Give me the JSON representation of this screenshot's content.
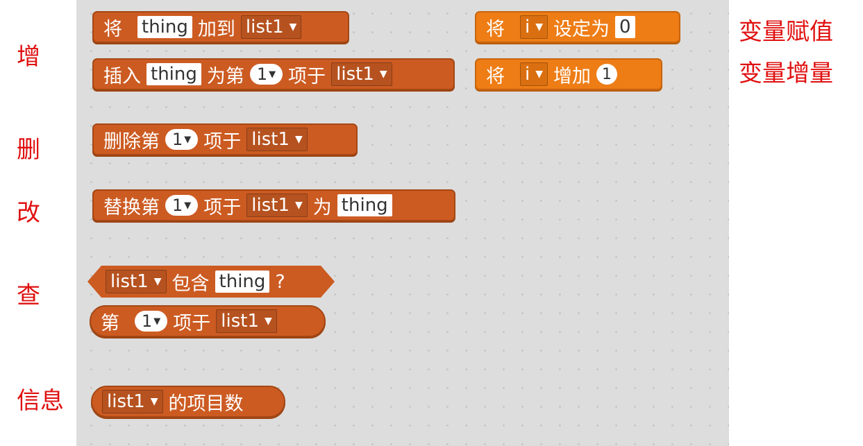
{
  "labels": {
    "add": "增",
    "delete": "删",
    "modify": "改",
    "query": "查",
    "info": "信息",
    "var_assign": "变量赋值",
    "var_increment": "变量增量"
  },
  "blocks": {
    "add_to_list": {
      "word1": "将",
      "item": "thing",
      "word2": "加到",
      "list": "list1"
    },
    "insert_at": {
      "word1": "插入",
      "item": "thing",
      "word2": "为第",
      "index": "1",
      "word3": "项于",
      "list": "list1"
    },
    "delete_item": {
      "word1": "删除第",
      "index": "1",
      "word2": "项于",
      "list": "list1"
    },
    "replace_item": {
      "word1": "替换第",
      "index": "1",
      "word2": "项于",
      "list": "list1",
      "word3": "为",
      "item": "thing"
    },
    "list_contains": {
      "list": "list1",
      "word1": "包含",
      "item": "thing",
      "suffix": "?"
    },
    "item_of": {
      "word1": "第",
      "index": "1",
      "word2": "项于",
      "list": "list1"
    },
    "length_of": {
      "list": "list1",
      "word1": "的项目数"
    },
    "set_var": {
      "word1": "将",
      "var": "i",
      "word2": "设定为",
      "value": "0"
    },
    "change_var": {
      "word1": "将",
      "var": "i",
      "word2": "增加",
      "value": "1"
    }
  },
  "icons": {
    "dropdown_caret": "▼"
  },
  "colors": {
    "list_block": "#cc5b22",
    "var_block": "#ee7d16",
    "label_text": "#e01010",
    "canvas": "#dddddd"
  }
}
